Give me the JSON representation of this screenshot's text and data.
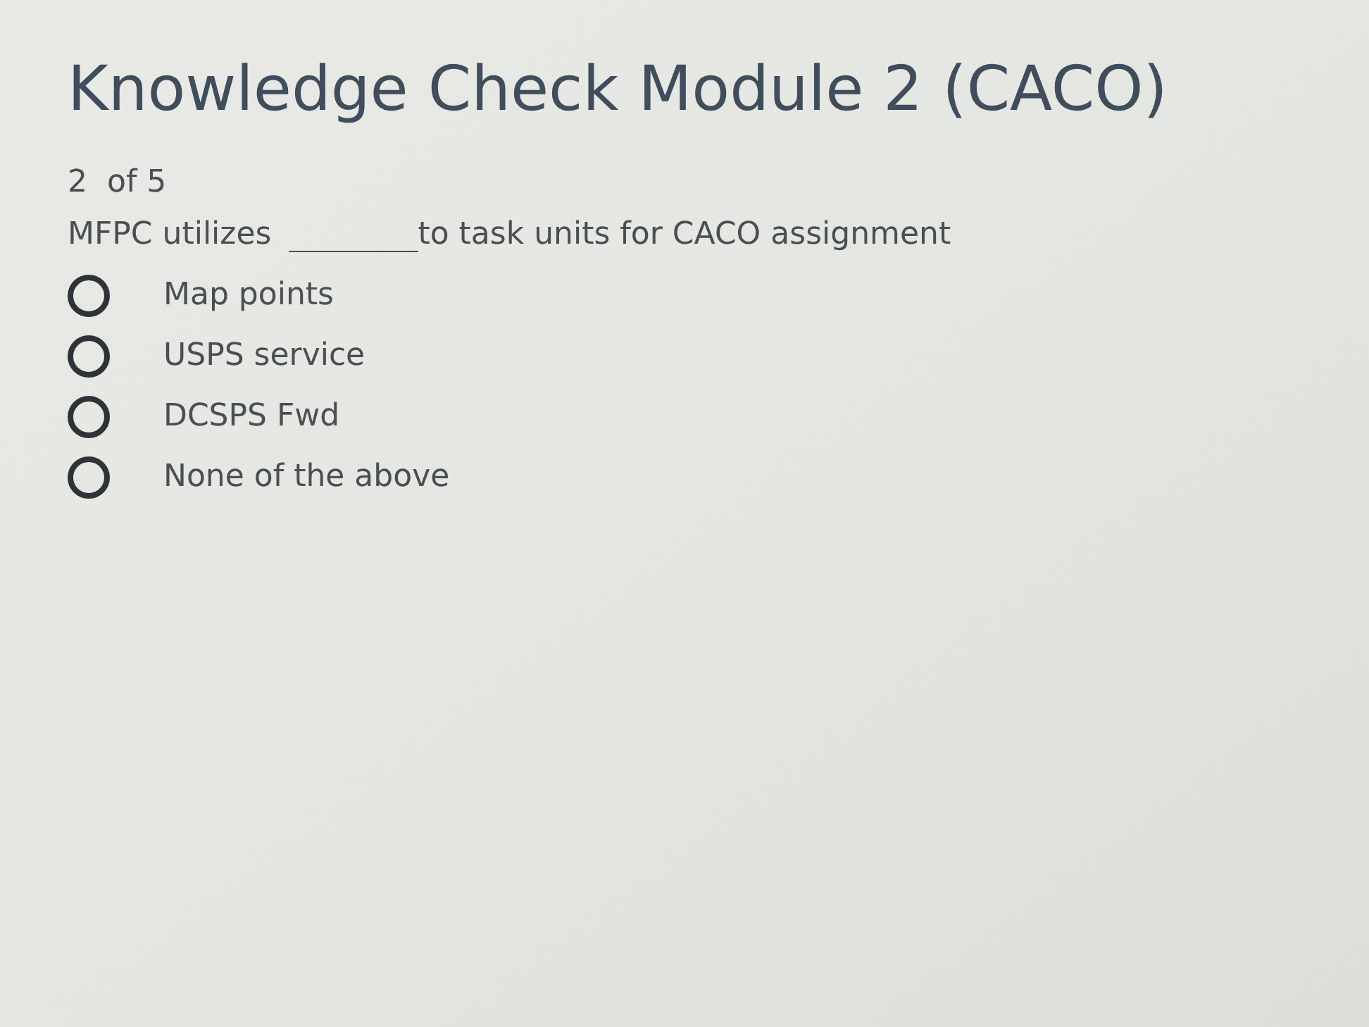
{
  "title": "Knowledge Check Module 2 (CACO)",
  "progress": "2  of 5",
  "question": {
    "before_blank": "MFPC utilizes",
    "after_blank": "to task units for CACO assignment"
  },
  "options": [
    {
      "label": "Map points",
      "selected": false
    },
    {
      "label": "USPS service",
      "selected": false
    },
    {
      "label": "DCSPS Fwd",
      "selected": false
    },
    {
      "label": "None of the above",
      "selected": false
    }
  ]
}
